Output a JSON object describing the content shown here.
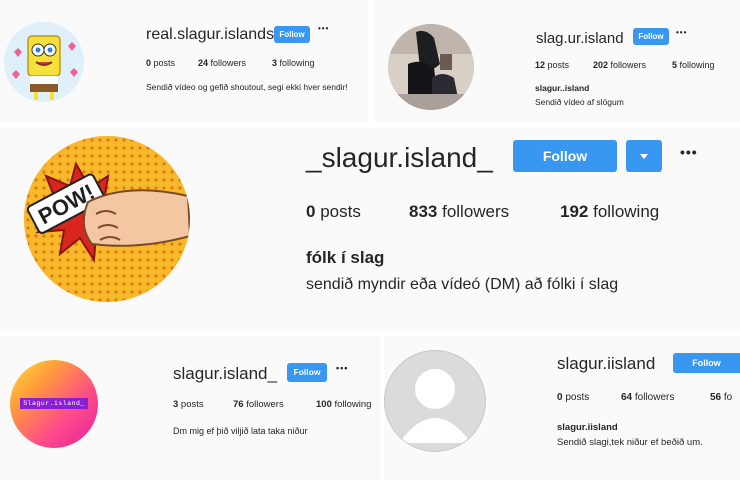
{
  "profiles": [
    {
      "username": "real.slagur.islands",
      "follow_label": "Follow",
      "more_label": "•••",
      "posts": "0",
      "posts_label": " posts",
      "followers": "24",
      "followers_label": " followers",
      "following": "3",
      "following_label": " following",
      "fullname": "",
      "bio": "Sendið vídeo og gefið shoutout, segi ekki hver sendir!"
    },
    {
      "username": "slag.ur.island",
      "follow_label": "Follow",
      "more_label": "•••",
      "posts": "12",
      "posts_label": " posts",
      "followers": "202",
      "followers_label": " followers",
      "following": "5",
      "following_label": " following",
      "fullname": "slagur..island",
      "bio": "Sendið vídeo af slögum"
    },
    {
      "username": "_slagur.island_",
      "follow_label": "Follow",
      "more_label": "•••",
      "posts": "0",
      "posts_label": " posts",
      "followers": "833",
      "followers_label": " followers",
      "following": "192",
      "following_label": " following",
      "fullname": "fólk í slag",
      "bio": "sendið myndir eða vídeó (DM) að fólki í slag"
    },
    {
      "username": "slagur.island_",
      "follow_label": "Follow",
      "more_label": "•••",
      "posts": "3",
      "posts_label": " posts",
      "followers": "76",
      "followers_label": " followers",
      "following": "100",
      "following_label": " following",
      "fullname": "",
      "bio": "Dm mig ef þið viljið lata taka niður",
      "avatar_text": "Slagur.island_"
    },
    {
      "username": "slagur.iisland",
      "follow_label": "Follow",
      "posts": "0",
      "posts_label": " posts",
      "followers": "64",
      "followers_label": " followers",
      "following": "56",
      "following_label": " fo",
      "fullname": "slagur.iisland",
      "bio": "Sendið slagi,tek niður ef beðið um."
    }
  ],
  "avatar_texts": {
    "pow": "POW!"
  },
  "colors": {
    "follow_button": "#3897f0",
    "panel_bg": "#fafafa",
    "text": "#262626"
  }
}
